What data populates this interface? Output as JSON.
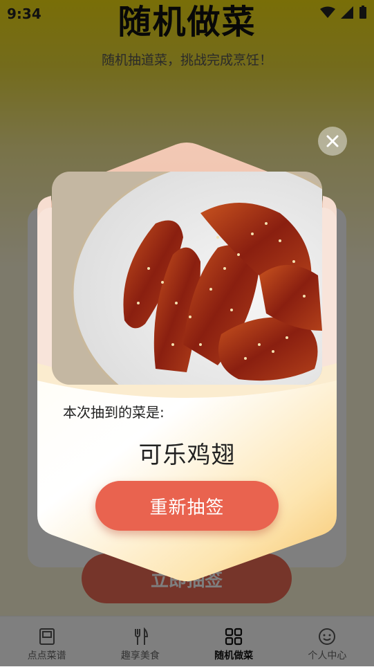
{
  "status": {
    "time": "9:34"
  },
  "page": {
    "title": "随机做菜",
    "subtitle": "随机抽道菜，挑战完成烹饪！",
    "draw_button": "立即抽签"
  },
  "tabs": [
    {
      "label": "点点菜谱",
      "icon": "book-icon",
      "active": false
    },
    {
      "label": "趣享美食",
      "icon": "utensils-icon",
      "active": false
    },
    {
      "label": "随机做菜",
      "icon": "grid-icon",
      "active": true
    },
    {
      "label": "个人中心",
      "icon": "smile-icon",
      "active": false
    }
  ],
  "modal": {
    "result_label": "本次抽到的菜是:",
    "dish_name": "可乐鸡翅",
    "redraw_button": "重新抽签",
    "close_icon": "close-icon"
  },
  "colors": {
    "accent": "#e9634f",
    "header_yellow": "#f2dc10",
    "modal_gold": "#f9d27a"
  }
}
